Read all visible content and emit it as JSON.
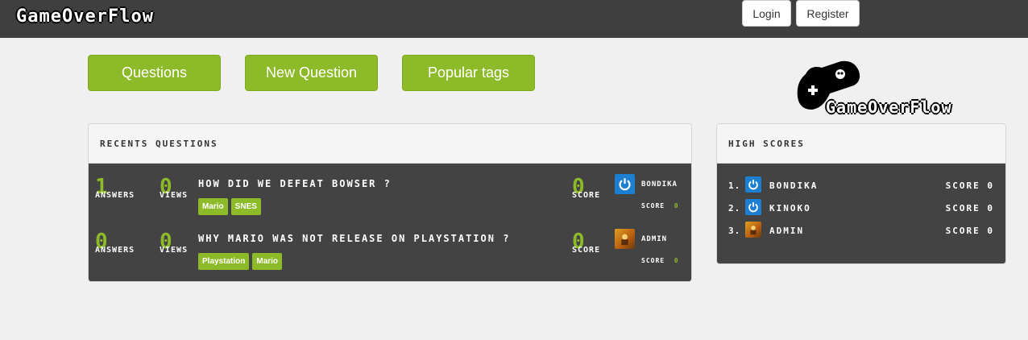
{
  "header": {
    "brand": "GameOverFlow",
    "login_label": "Login",
    "register_label": "Register"
  },
  "nav": {
    "questions": "Questions",
    "new_question": "New Question",
    "popular_tags": "Popular tags"
  },
  "logo": {
    "text": "GameOverFlow"
  },
  "recent": {
    "title": "Recents questions",
    "questions": [
      {
        "answers": "1",
        "answers_label": "Answers",
        "views": "0",
        "views_label": "Views",
        "title": "How did we defeat Bowser ?",
        "tags": [
          "Mario",
          "SNES"
        ],
        "score": "0",
        "score_label": "Score",
        "user": "Bondika",
        "user_score_label": "Score",
        "user_score": "0"
      },
      {
        "answers": "0",
        "answers_label": "Answers",
        "views": "0",
        "views_label": "Views",
        "title": "Why Mario was not release on Playstation ?",
        "tags": [
          "Playstation",
          "Mario"
        ],
        "score": "0",
        "score_label": "Score",
        "user": "Admin",
        "user_score_label": "Score",
        "user_score": "0"
      }
    ]
  },
  "high_scores": {
    "title": "High scores",
    "entries": [
      {
        "rank": "1.",
        "name": "Bondika",
        "score": "Score 0"
      },
      {
        "rank": "2.",
        "name": "Kinoko",
        "score": "Score 0"
      },
      {
        "rank": "3.",
        "name": "Admin",
        "score": "Score 0"
      }
    ]
  },
  "colors": {
    "accent": "#8dba28",
    "bar": "#3f3f3f",
    "panel": "#434343"
  }
}
